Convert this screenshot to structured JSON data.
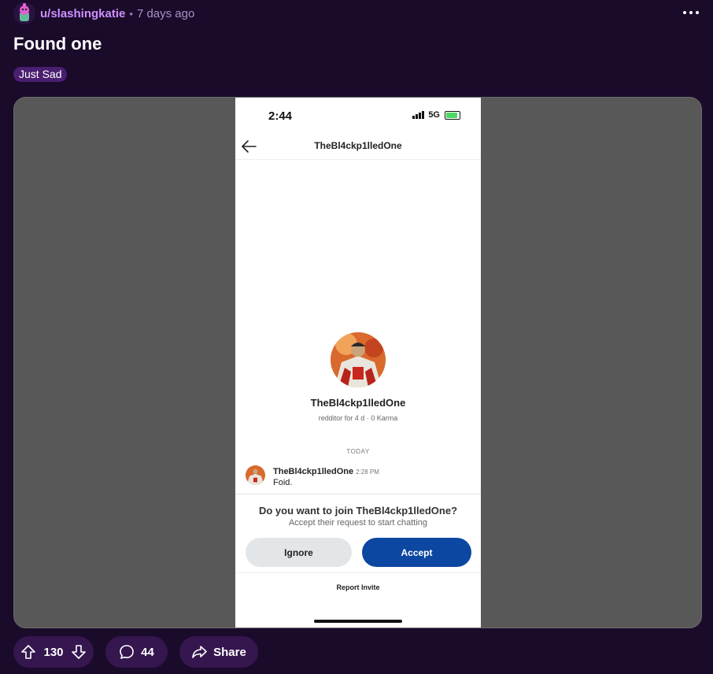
{
  "post": {
    "username": "u/slashingkatie",
    "separator": "•",
    "time": "7 days ago",
    "title": "Found one",
    "flair": "Just Sad"
  },
  "screenshot": {
    "clock": "2:44",
    "network": "5G",
    "nav_title": "TheBl4ckp1lledOne",
    "profile_name": "TheBl4ckp1lledOne",
    "profile_meta": "redditor for 4 d · 0 Karma",
    "day_divider": "TODAY",
    "message": {
      "author": "TheBl4ckp1lledOne",
      "time": "2:28 PM",
      "text": "Foid."
    },
    "question": "Do you want to join TheBl4ckp1lledOne?",
    "question_sub": "Accept their request to start chatting",
    "ignore_label": "Ignore",
    "accept_label": "Accept",
    "report_label": "Report Invite"
  },
  "actions": {
    "votes": "130",
    "comments": "44",
    "share_label": "Share"
  },
  "icons": [
    "more-icon",
    "back-arrow-icon",
    "upvote-icon",
    "downvote-icon",
    "comment-icon",
    "share-icon"
  ],
  "colors": {
    "background": "#1a0b2b",
    "username": "#cf8fff",
    "pill": "#35164f",
    "accept": "#0c47a1"
  }
}
